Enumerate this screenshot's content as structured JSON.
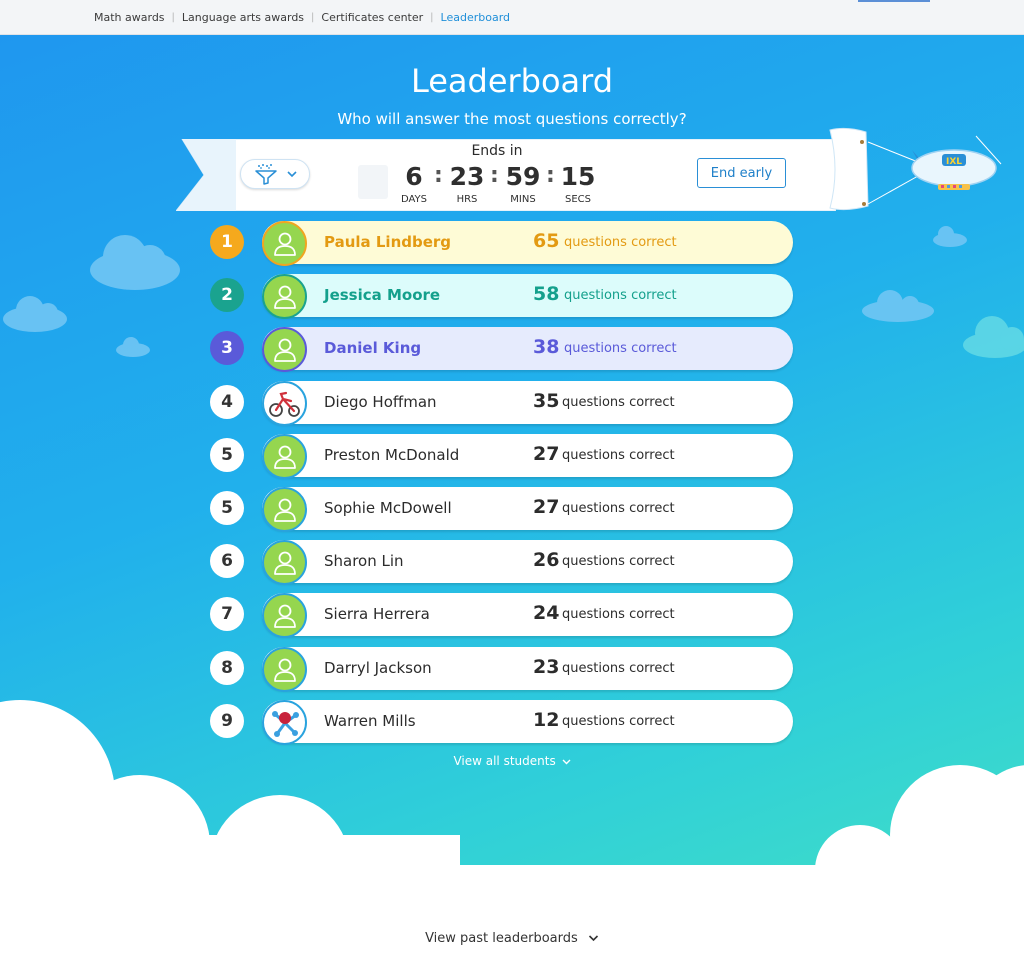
{
  "nav": {
    "items": [
      "Math awards",
      "Language arts awards",
      "Certificates center",
      "Leaderboard"
    ]
  },
  "header": {
    "title": "Leaderboard",
    "subtitle": "Who will answer the most questions correctly?"
  },
  "timer": {
    "ends_in": "Ends in",
    "days": "6",
    "days_label": "DAYS",
    "hrs": "23",
    "hrs_label": "HRS",
    "mins": "59",
    "mins_label": "MINS",
    "secs": "15",
    "secs_label": "SECS"
  },
  "controls": {
    "end_early": "End early",
    "filter_icon": "filter-icon"
  },
  "blimp": {
    "logo": "IXL"
  },
  "questions_label": "questions correct",
  "students": [
    {
      "rank": "1",
      "name": "Paula Lindberg",
      "score": "65",
      "avatar": "user-icon"
    },
    {
      "rank": "2",
      "name": "Jessica Moore",
      "score": "58",
      "avatar": "user-icon"
    },
    {
      "rank": "3",
      "name": "Daniel King",
      "score": "38",
      "avatar": "user-icon"
    },
    {
      "rank": "4",
      "name": "Diego Hoffman",
      "score": "35",
      "avatar": "tricycle-icon"
    },
    {
      "rank": "5",
      "name": "Preston McDonald",
      "score": "27",
      "avatar": "user-icon"
    },
    {
      "rank": "5",
      "name": "Sophie McDowell",
      "score": "27",
      "avatar": "user-icon"
    },
    {
      "rank": "6",
      "name": "Sharon Lin",
      "score": "26",
      "avatar": "user-icon"
    },
    {
      "rank": "7",
      "name": "Sierra Herrera",
      "score": "24",
      "avatar": "user-icon"
    },
    {
      "rank": "8",
      "name": "Darryl Jackson",
      "score": "23",
      "avatar": "user-icon"
    },
    {
      "rank": "9",
      "name": "Warren Mills",
      "score": "12",
      "avatar": "molecule-icon"
    }
  ],
  "top3_colors": {
    "1": {
      "badge": "#f5a91d",
      "bg": "#fefbd6",
      "text": "#e39a12",
      "ring": "#f0a521"
    },
    "2": {
      "badge": "#1aa38f",
      "bg": "#dcfcfb",
      "text": "#14a08c",
      "ring": "#1aa38f"
    },
    "3": {
      "badge": "#5a5ad9",
      "bg": "#e6ebfd",
      "text": "#5a5ad9",
      "ring": "#5a5ad9"
    }
  },
  "footer": {
    "view_all": "View all students",
    "view_past": "View past leaderboards"
  }
}
